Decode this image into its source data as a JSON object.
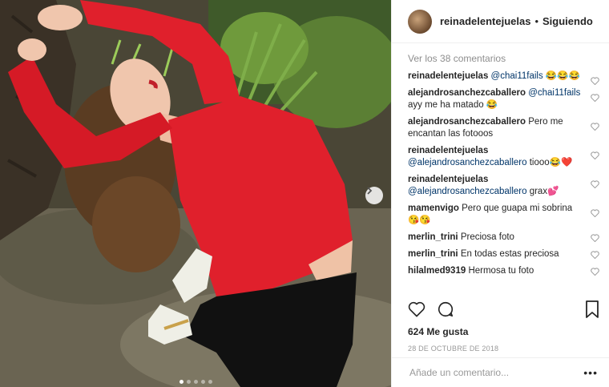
{
  "post": {
    "username": "reinadelentejuelas",
    "separator": "•",
    "follow_status": "Siguiendo",
    "load_more": "Ver los 38 comentarios",
    "likes": "624 Me gusta",
    "date": "28 DE OCTUBRE DE 2018",
    "add_comment_placeholder": "Añade un comentario...",
    "more_label": "•••",
    "carousel_count": 5,
    "carousel_active": 1
  },
  "comments": [
    {
      "user": "reinadelentejuelas",
      "mention": "@chai11fails",
      "text": " 😂😂😂"
    },
    {
      "user": "alejandrosanchezcaballero",
      "mention": "@chai11fails",
      "text": " ayy me ha matado 😂"
    },
    {
      "user": "alejandrosanchezcaballero",
      "mention": "",
      "text": "Pero me encantan las fotooos"
    },
    {
      "user": "reinadelentejuelas",
      "mention": "@alejandrosanchezcaballero",
      "text": " tiooo😂❤️"
    },
    {
      "user": "reinadelentejuelas",
      "mention": "@alejandrosanchezcaballero",
      "text": " grax💕"
    },
    {
      "user": "mamenvigo",
      "mention": "",
      "text": "Pero que guapa mi sobrina 😘😘"
    },
    {
      "user": "merlin_trini",
      "mention": "",
      "text": "Preciosa foto"
    },
    {
      "user": "merlin_trini",
      "mention": "",
      "text": "En todas estas preciosa"
    },
    {
      "user": "hilalmed9319",
      "mention": "",
      "text": "Hermosa tu foto"
    }
  ],
  "colors": {
    "sweater": "#e0202c",
    "link": "#003569",
    "muted": "#8e8e8e"
  },
  "icons": {
    "like": "heart-icon",
    "comment": "comment-bubble-icon",
    "save": "bookmark-icon",
    "next": "chevron-right-icon"
  }
}
